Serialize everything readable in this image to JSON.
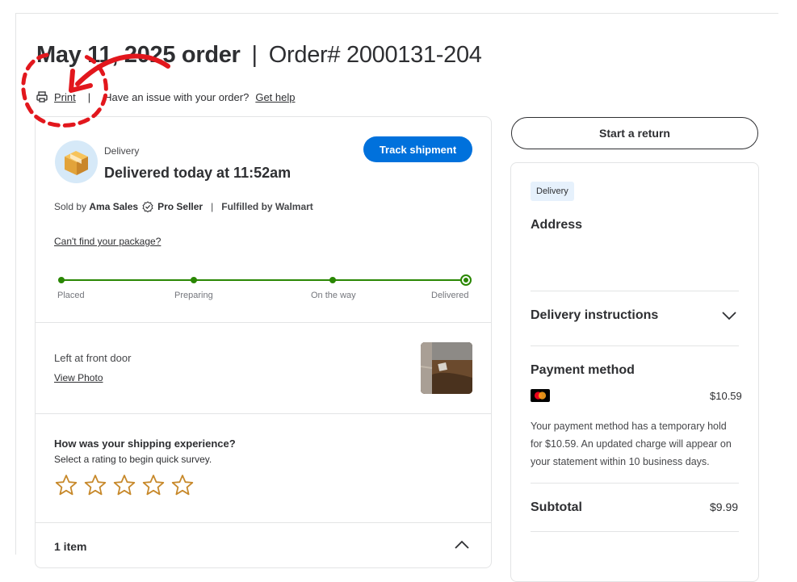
{
  "header": {
    "order_date": "May 11, 2025 order",
    "separator": "|",
    "order_number": "Order# 2000131-204",
    "print_label": "Print",
    "issue_text": "Have an issue with your order?",
    "get_help_label": "Get help"
  },
  "shipment": {
    "type_label": "Delivery",
    "status": "Delivered today at 11:52am",
    "track_label": "Track shipment",
    "sold_by_prefix": "Sold by",
    "seller_name": "Ama Sales",
    "seller_badge": "Pro Seller",
    "fulfilled": "Fulfilled by Walmart",
    "cant_find_label": "Can't find your package?",
    "steps": [
      "Placed",
      "Preparing",
      "On the way",
      "Delivered"
    ],
    "current_step": 4,
    "left_at": "Left at front door",
    "view_photo_label": "View Photo"
  },
  "survey": {
    "question": "How was your shipping experience?",
    "subtitle": "Select a rating to begin quick survey.",
    "max_rating": 5
  },
  "items": {
    "label": "1 item"
  },
  "sidebar": {
    "return_label": "Start a return",
    "delivery_tag": "Delivery",
    "address_heading": "Address",
    "instructions_heading": "Delivery instructions",
    "payment_heading": "Payment method",
    "payment_amount": "$10.59",
    "hold_text": "Your payment method has a temporary hold for $10.59. An updated charge will appear on your statement within 10 business days.",
    "subtotal_label": "Subtotal",
    "subtotal_value": "$9.99"
  },
  "colors": {
    "brand_blue": "#0071dc",
    "progress_green": "#2a8703",
    "star_gold": "#c7892b",
    "annotation_red": "#e2171d"
  },
  "icons": [
    "printer-icon",
    "package-icon",
    "verified-badge-icon",
    "star-icon",
    "chevron-up-icon",
    "chevron-down-icon",
    "mastercard-icon",
    "red-arrow-annotation"
  ]
}
